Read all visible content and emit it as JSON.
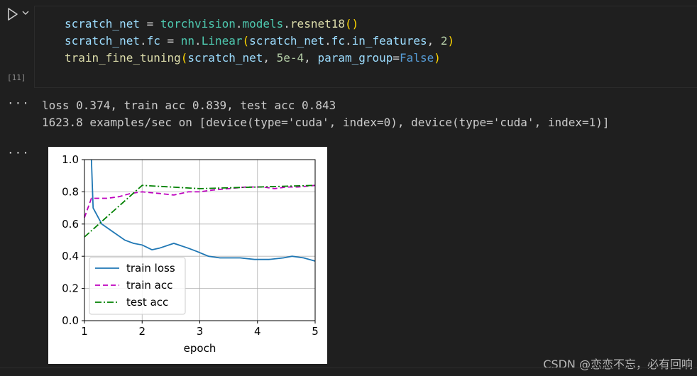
{
  "cell": {
    "exec_count": "[11]",
    "code_lines": [
      [
        {
          "t": "scratch_net",
          "c": "v"
        },
        {
          "t": " = ",
          "c": "p"
        },
        {
          "t": "torchvision",
          "c": "t"
        },
        {
          "t": ".",
          "c": "p"
        },
        {
          "t": "models",
          "c": "t"
        },
        {
          "t": ".",
          "c": "p"
        },
        {
          "t": "resnet18",
          "c": "f"
        },
        {
          "t": "()",
          "c": "b1"
        }
      ],
      [
        {
          "t": "scratch_net",
          "c": "v"
        },
        {
          "t": ".",
          "c": "p"
        },
        {
          "t": "fc",
          "c": "v"
        },
        {
          "t": " = ",
          "c": "p"
        },
        {
          "t": "nn",
          "c": "t"
        },
        {
          "t": ".",
          "c": "p"
        },
        {
          "t": "Linear",
          "c": "t"
        },
        {
          "t": "(",
          "c": "b1"
        },
        {
          "t": "scratch_net",
          "c": "v"
        },
        {
          "t": ".",
          "c": "p"
        },
        {
          "t": "fc",
          "c": "v"
        },
        {
          "t": ".",
          "c": "p"
        },
        {
          "t": "in_features",
          "c": "v"
        },
        {
          "t": ", ",
          "c": "p"
        },
        {
          "t": "2",
          "c": "n"
        },
        {
          "t": ")",
          "c": "b1"
        }
      ],
      [
        {
          "t": "train_fine_tuning",
          "c": "f"
        },
        {
          "t": "(",
          "c": "b1"
        },
        {
          "t": "scratch_net",
          "c": "v"
        },
        {
          "t": ", ",
          "c": "p"
        },
        {
          "t": "5e-4",
          "c": "n"
        },
        {
          "t": ", ",
          "c": "p"
        },
        {
          "t": "param_group",
          "c": "v"
        },
        {
          "t": "=",
          "c": "p"
        },
        {
          "t": "False",
          "c": "kw"
        },
        {
          "t": ")",
          "c": "b1"
        }
      ]
    ]
  },
  "output": {
    "dots": "···",
    "stdout_lines": [
      "loss 0.374, train acc 0.839, test acc 0.843",
      "1623.8 examples/sec on [device(type='cuda', index=0), device(type='cuda', index=1)]"
    ]
  },
  "chart_data": {
    "type": "line",
    "xlabel": "epoch",
    "ylabel": "",
    "xlim": [
      1,
      5
    ],
    "ylim": [
      0,
      1
    ],
    "xticks": [
      "1",
      "2",
      "3",
      "4",
      "5"
    ],
    "yticks": [
      "0.0",
      "0.2",
      "0.4",
      "0.6",
      "0.8",
      "1.0"
    ],
    "grid": true,
    "legend_position": "lower-left",
    "series": [
      {
        "name": "train loss",
        "color": "#1f77b4",
        "dash": "solid",
        "x": [
          1.12,
          1.15,
          1.3,
          1.5,
          1.7,
          1.85,
          2.0,
          2.17,
          2.3,
          2.55,
          2.8,
          2.95,
          3.15,
          3.35,
          3.5,
          3.7,
          3.95,
          4.2,
          4.45,
          4.6,
          4.8,
          5.0
        ],
        "y": [
          1.0,
          0.7,
          0.6,
          0.55,
          0.5,
          0.48,
          0.47,
          0.44,
          0.45,
          0.48,
          0.45,
          0.43,
          0.4,
          0.39,
          0.39,
          0.39,
          0.38,
          0.38,
          0.39,
          0.4,
          0.39,
          0.37
        ]
      },
      {
        "name": "train acc",
        "color": "#bf00bf",
        "dash": "dashed",
        "x": [
          1.0,
          1.12,
          1.25,
          1.4,
          1.6,
          1.8,
          2.0,
          2.3,
          2.55,
          2.8,
          3.0,
          3.2,
          3.5,
          3.8,
          4.1,
          4.3,
          4.5,
          4.7,
          5.0
        ],
        "y": [
          0.64,
          0.76,
          0.76,
          0.76,
          0.77,
          0.79,
          0.8,
          0.79,
          0.78,
          0.8,
          0.8,
          0.81,
          0.82,
          0.83,
          0.83,
          0.82,
          0.83,
          0.83,
          0.84
        ]
      },
      {
        "name": "test acc",
        "color": "#008000",
        "dash": "dashdot",
        "x": [
          1,
          2,
          3,
          4,
          5
        ],
        "y": [
          0.52,
          0.84,
          0.82,
          0.83,
          0.84
        ]
      }
    ]
  },
  "watermark": "CSDN @恋恋不忘，必有回响"
}
